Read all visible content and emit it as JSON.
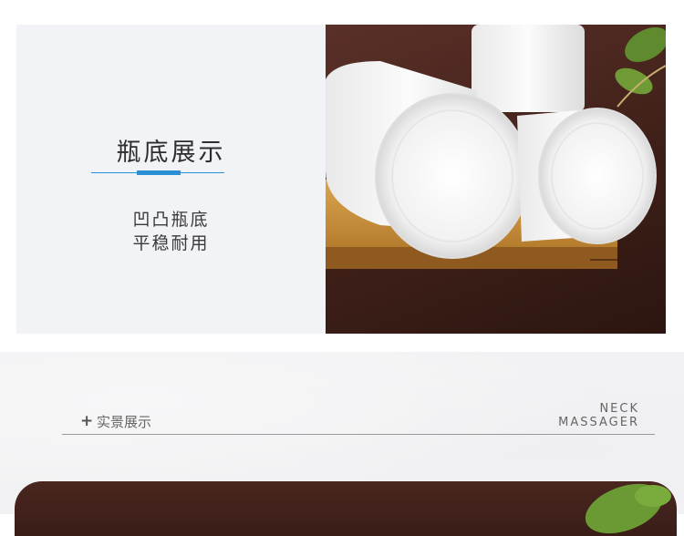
{
  "feature": {
    "title": "瓶底展示",
    "desc_line1": "凹凸瓶底",
    "desc_line2": "平稳耐用"
  },
  "section": {
    "label": "实景展示",
    "brand_line1": "NECK",
    "brand_line2": "MASSAGER"
  },
  "colors": {
    "accent": "#2b8fd6",
    "panel_bg": "#f1f3f7",
    "photo_bg": "#3f2019"
  }
}
